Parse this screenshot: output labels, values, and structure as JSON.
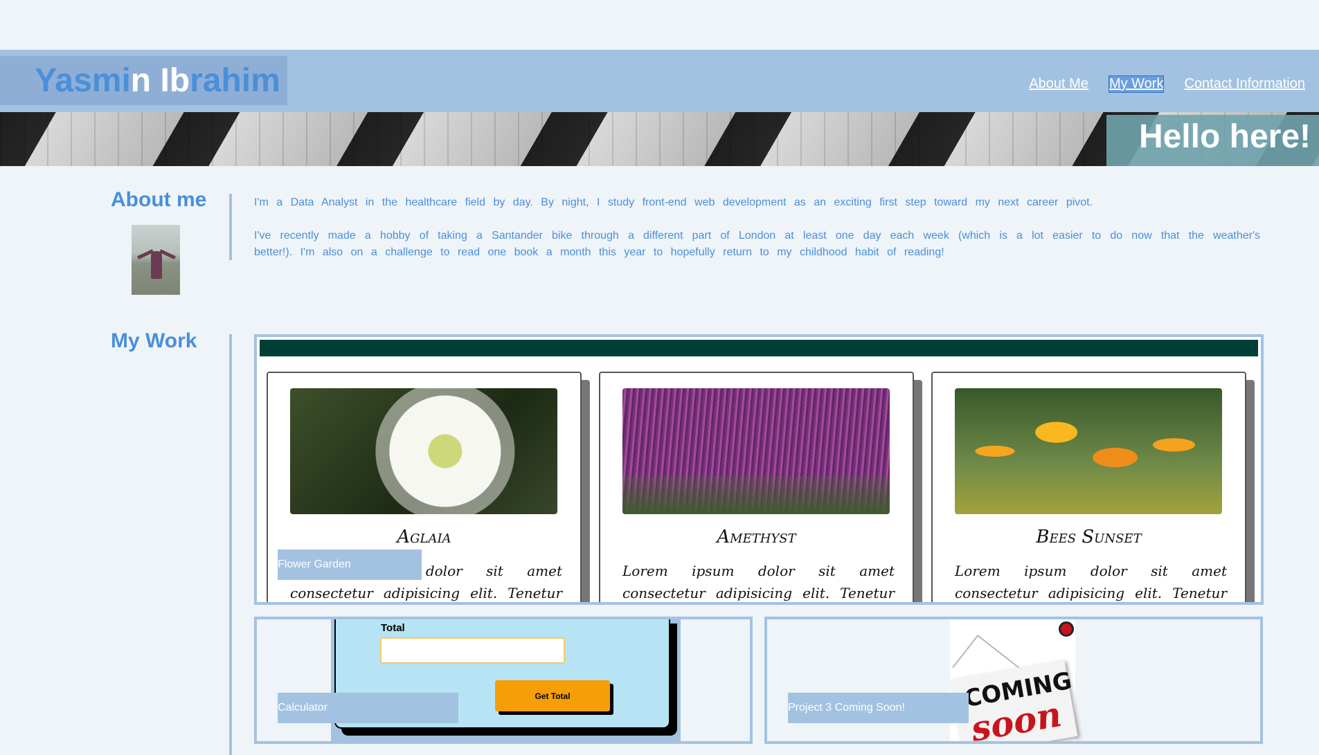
{
  "header": {
    "name_first": "Yasmi",
    "name_mid": "n Ib",
    "name_last": "rahim",
    "nav": [
      {
        "label": "About Me",
        "active": false
      },
      {
        "label": "My Work",
        "active": true
      },
      {
        "label": "Contact Information",
        "active": false
      }
    ]
  },
  "banner": {
    "greeting": "Hello here!"
  },
  "about": {
    "title": "About me",
    "paragraphs": [
      "I'm a Data Analyst in the healthcare field by day. By night, I study front-end web development as an exciting first step toward my next career pivot.",
      "I've recently made a hobby of taking a Santander bike through a different part of London at least one day each week (which is a lot easier to do now that the weather's better!). I'm also on a challenge to read one book a month this year to hopefully return to my childhood habit of reading!"
    ]
  },
  "work": {
    "title": "My Work",
    "project1": {
      "tag": "Flower Garden",
      "cards": [
        {
          "title": "Aglaia",
          "body": "Lorem ipsum dolor sit amet consectetur adipisicing elit. Tenetur recusandae sed"
        },
        {
          "title": "Amethyst",
          "body": "Lorem ipsum dolor sit amet consectetur adipisicing elit. Tenetur recusandae sed"
        },
        {
          "title": "Bees Sunset",
          "body": "Lorem ipsum dolor sit amet consectetur adipisicing elit. Tenetur recusandae sed"
        }
      ]
    },
    "project2": {
      "tag": "Calculator",
      "label": "Total",
      "input_value": "",
      "button": "Get Total"
    },
    "project3": {
      "tag": "Project 3 Coming Soon!",
      "sign_line1": "COMING",
      "sign_line2": "soon"
    }
  },
  "colors": {
    "header_bg": "#a3c2e1",
    "accent_blue": "#4a8fd9",
    "page_bg": "#eff4f9",
    "dark_green": "#003f38",
    "button_orange": "#f59e08"
  }
}
